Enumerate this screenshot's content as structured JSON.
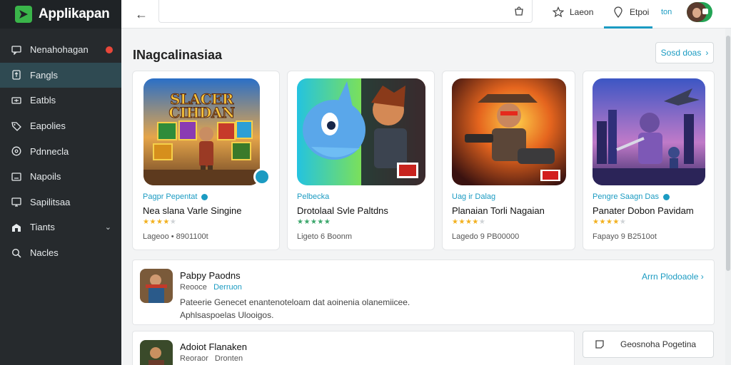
{
  "app": {
    "name": "Applikapan"
  },
  "sidebar": {
    "items": [
      {
        "label": "Nenahohagan",
        "icon": "chat-icon",
        "badge": true
      },
      {
        "label": "Fangls",
        "icon": "gamepad-icon",
        "active": true
      },
      {
        "label": "Eatbls",
        "icon": "grid-icon"
      },
      {
        "label": "Eapolies",
        "icon": "tag-icon"
      },
      {
        "label": "Pdnnecla",
        "icon": "compass-icon"
      },
      {
        "label": "Napoils",
        "icon": "document-icon"
      },
      {
        "label": "Sapilitsaa",
        "icon": "monitor-icon"
      },
      {
        "label": "Tiants",
        "icon": "building-icon",
        "chevron": true
      },
      {
        "label": "Nacles",
        "icon": "search-icon"
      }
    ]
  },
  "topbar": {
    "search_value": "",
    "link1": "Laeon",
    "link2": "Etpoi",
    "ver": "ton"
  },
  "main": {
    "section_title": "INagcalinasiaa",
    "see_more": "Sosd doas"
  },
  "cards": [
    {
      "category": "Pagpr Pepentat",
      "title": "Nea slana Varle Singine",
      "rating": 4,
      "meta": "Lageoo • 8901100t",
      "verified": true,
      "info": true,
      "art_text": "SLACER CIHDAN"
    },
    {
      "category": "Pelbecka",
      "title": "Drotolaal Svle Paltdns",
      "rating": 5,
      "meta": "Ligeto 6 Boonm",
      "verified": false,
      "info": false,
      "art_text": ""
    },
    {
      "category": "Uag ir Dalag",
      "title": "Planaian Torli Nagaian",
      "rating": 4,
      "meta": "Lagedo 9 PB00000",
      "verified": false,
      "info": false,
      "art_text": ""
    },
    {
      "category": "Pengre Saagn Das",
      "title": "Panater Dobon Pavidam",
      "rating": 4,
      "meta": "Fapayo 9 B2510ot",
      "verified": false,
      "info": true,
      "art_text": ""
    }
  ],
  "list": [
    {
      "name": "Pabpy Paodns",
      "sub1": "Reooce",
      "sub2": "Derruon",
      "desc1": "Pateerie Genecet enantenoteloam dat aoinenia olanemiicee.",
      "desc2": "Aphlsaspoelas Ulooigos.",
      "link": "Arrn Plodoaole"
    },
    {
      "name": "Adoiot Flanaken",
      "sub1": "Reoraor",
      "sub2": "Dronten",
      "desc1": "",
      "desc2": "",
      "link": ""
    }
  ],
  "side_button": {
    "label": "Geosnoha Pogetina"
  },
  "colors": {
    "accent": "#1b9bc2",
    "sidebar": "#262a2d",
    "active": "#2f4a52",
    "badge": "#e8473a",
    "star": "#f2b01e",
    "star_green": "#3aa66a"
  }
}
